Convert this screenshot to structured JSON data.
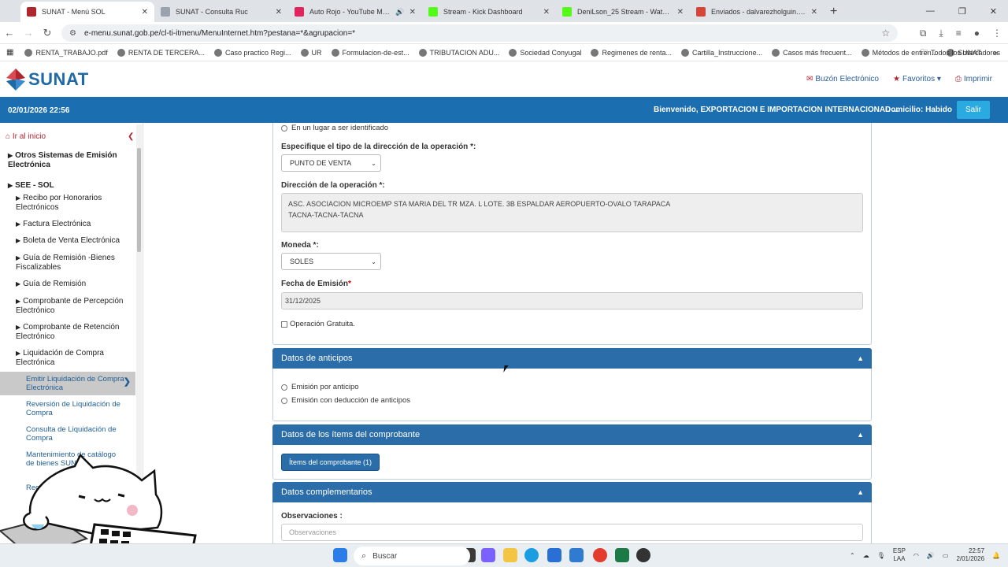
{
  "browser": {
    "tabs": [
      {
        "title": "SUNAT - Menú SOL",
        "active": true,
        "favicon_color": "#b0262f"
      },
      {
        "title": "SUNAT - Consulta Ruc",
        "active": false,
        "favicon_color": "#9aa3ad"
      },
      {
        "title": "Auto Rojo - YouTube Music",
        "active": false,
        "favicon_color": "#e0245e",
        "audio": true
      },
      {
        "title": "Stream - Kick Dashboard",
        "active": false,
        "favicon_color": "#53fc18"
      },
      {
        "title": "DeniLson_25 Stream - Watch Li",
        "active": false,
        "favicon_color": "#53fc18"
      },
      {
        "title": "Enviados - dalvarezholguin.25@",
        "active": false,
        "favicon_color": "#d44638"
      }
    ],
    "url": "e-menu.sunat.gob.pe/cl-ti-itmenu/MenuInternet.htm?pestana=*&agrupacion=*",
    "bookmarks": [
      "RENTA_TRABAJO.pdf",
      "RENTA DE TERCERA...",
      "Caso practico Regi...",
      "UR",
      "Formulacion-de-est...",
      "TRIBUTACION ADU...",
      "Sociedad Conyugal",
      "Regimenes de renta...",
      "Cartilla_Instruccione...",
      "Casos más frecuent...",
      "Métodos de entren...",
      "SUNAT"
    ],
    "bookmarks_more": "»",
    "all_bookmarks": "Todos los marcadores"
  },
  "header": {
    "logo_text": "SUNAT",
    "links": [
      {
        "icon": "envelope-icon",
        "glyph": "✉",
        "label": "Buzón Electrónico"
      },
      {
        "icon": "star-icon",
        "glyph": "★",
        "label": "Favoritos ▾"
      },
      {
        "icon": "printer-icon",
        "glyph": "⎙",
        "label": "Imprimir"
      }
    ]
  },
  "infobar": {
    "datetime": "02/01/2026 22:56",
    "welcome": "Bienvenido, EXPORTACION E IMPORTACION INTERNACIONAL ...",
    "domicilio": "Domicilio: Habido",
    "salir": "Salir"
  },
  "sidebar": {
    "back_label": "Ir al inicio",
    "items": [
      "Otros Sistemas de Emisión Electrónica",
      "SEE - SOL",
      "Recibo por Honorarios Electrónicos",
      "Factura Electrónica",
      "Boleta de Venta Electrónica",
      "Guía de Remisión -Bienes Fiscalizables",
      "Guía de Remisión",
      "Comprobante de Percepción Electrónico",
      "Comprobante de Retención Electrónico",
      "Liquidación de Compra Electrónica"
    ],
    "subitems": [
      "Emitir Liquidación de Compra Electrónica",
      "Reversión de Liquidación de Compra",
      "Consulta de Liquidación de Compra",
      "Mantenimiento de catálogo de bienes SUNAT",
      "Registro... Liquid..."
    ]
  },
  "form": {
    "radio_lugar": "En un lugar a ser identificado",
    "tipo_direccion_label": "Especifique el tipo de la dirección de la operación *:",
    "tipo_direccion_value": "PUNTO DE VENTA",
    "direccion_label": "Dirección de la operación *:",
    "direccion_value_1": "ASC. ASOCIACION MICROEMP STA MARIA DEL TR MZA. L    LOTE. 3B   ESPALDAR AEROPUERTO-OVALO TARAPACA",
    "direccion_value_2": "TACNA-TACNA-TACNA",
    "moneda_label": "Moneda *:",
    "moneda_value": "SOLES",
    "fecha_label": "Fecha de Emisión",
    "fecha_req": "*",
    "fecha_value": "31/12/2025",
    "gratuita_label": "Operación Gratuita."
  },
  "anticipos": {
    "title": "Datos de anticipos",
    "options": [
      "Emisión por anticipo",
      "Emisión con deducción de anticipos"
    ]
  },
  "items": {
    "title": "Datos de los ítems del comprobante",
    "button": "Ítems del comprobante (1)"
  },
  "complementarios": {
    "title": "Datos complementarios",
    "obs_label": "Observaciones :",
    "obs_placeholder": "Observaciones"
  },
  "taskbar": {
    "search": "Buscar",
    "lang_1": "ESP",
    "lang_2": "LAA",
    "time": "22:57",
    "date": "2/01/2026"
  }
}
